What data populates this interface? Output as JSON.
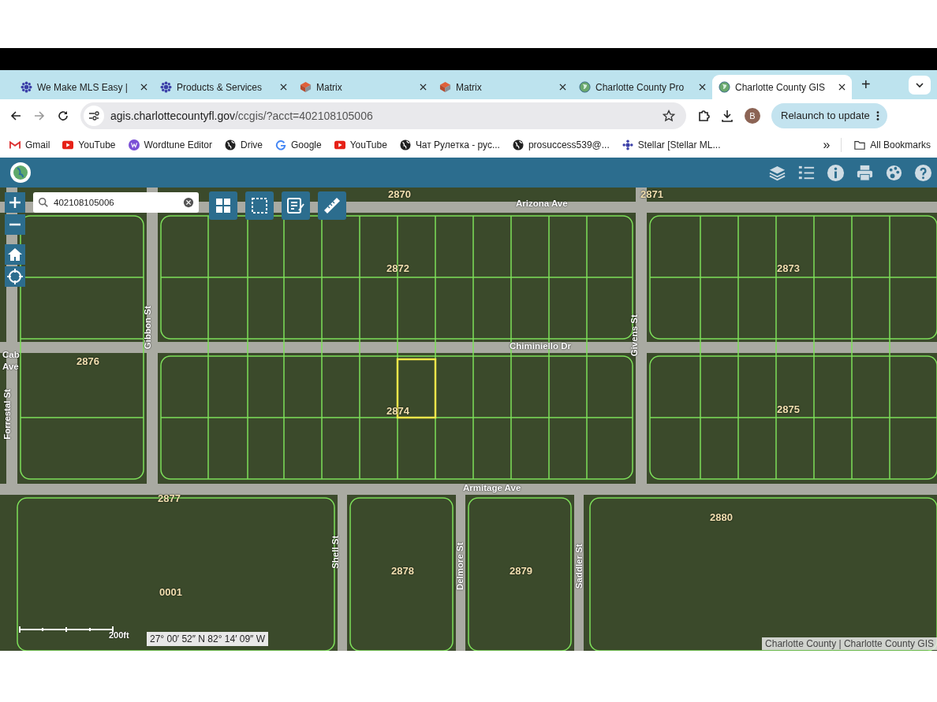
{
  "tabs": [
    {
      "title": "We Make MLS Easy |",
      "selected": false
    },
    {
      "title": "Products & Services",
      "selected": false
    },
    {
      "title": "Matrix",
      "selected": false
    },
    {
      "title": "Matrix",
      "selected": false
    },
    {
      "title": "Charlotte County Pro",
      "selected": false
    },
    {
      "title": "Charlotte County GIS",
      "selected": true
    }
  ],
  "new_tab": "+",
  "address": {
    "host": "agis.charlottecountyfl.gov",
    "path": "/ccgis/?acct=402108105006"
  },
  "profile": "B",
  "relaunch": "Relaunch to update",
  "bookmarks": [
    {
      "label": "Gmail"
    },
    {
      "label": "YouTube"
    },
    {
      "label": "Wordtune Editor"
    },
    {
      "label": "Drive"
    },
    {
      "label": "Google"
    },
    {
      "label": "YouTube"
    },
    {
      "label": "Чат Рулетка - рус..."
    },
    {
      "label": "prosuccess539@..."
    },
    {
      "label": "Stellar [Stellar ML..."
    }
  ],
  "overflow": "»",
  "all_bookmarks": "All Bookmarks",
  "search": {
    "value": "402108105006"
  },
  "map_labels": [
    {
      "text": "2870",
      "kind": "block"
    },
    {
      "text": "2871",
      "kind": "block"
    },
    {
      "text": "Arizona Ave",
      "kind": "street"
    },
    {
      "text": "2872",
      "kind": "block"
    },
    {
      "text": "2873",
      "kind": "block"
    },
    {
      "text": "Chiminiello Dr",
      "kind": "street"
    },
    {
      "text": "Gibbon St",
      "kind": "street"
    },
    {
      "text": "Givens St",
      "kind": "street"
    },
    {
      "text": "Cab",
      "kind": "street"
    },
    {
      "text": "Ave",
      "kind": "street"
    },
    {
      "text": "Forrestal St",
      "kind": "street"
    },
    {
      "text": "2876",
      "kind": "block"
    },
    {
      "text": "2874",
      "kind": "block"
    },
    {
      "text": "2875",
      "kind": "block"
    },
    {
      "text": "Armitage Ave",
      "kind": "street"
    },
    {
      "text": "2877",
      "kind": "block"
    },
    {
      "text": "2880",
      "kind": "block"
    },
    {
      "text": "Shell St",
      "kind": "street"
    },
    {
      "text": "Delmore St",
      "kind": "street"
    },
    {
      "text": "Saddler St",
      "kind": "street"
    },
    {
      "text": "2878",
      "kind": "block"
    },
    {
      "text": "2879",
      "kind": "block"
    },
    {
      "text": "0001",
      "kind": "block"
    }
  ],
  "scale": {
    "label": "200ft"
  },
  "coordinates": "27° 00′ 52″ N 82° 14′ 09″ W",
  "attribution": "Charlotte County | Charlotte County GIS"
}
